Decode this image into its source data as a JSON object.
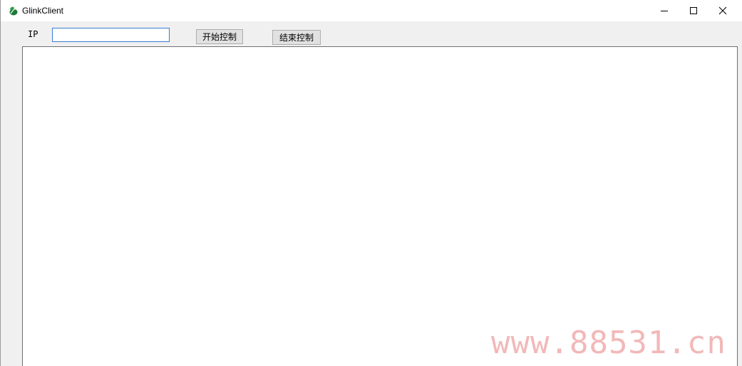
{
  "window": {
    "title": "GlinkClient",
    "icon": "leaf-app-icon",
    "controls": {
      "minimize": "minimize-icon",
      "maximize": "maximize-icon",
      "close": "close-icon"
    }
  },
  "toolbar": {
    "ip_label": "IP",
    "ip_value": "",
    "start_label": "开始控制",
    "stop_label": "结束控制"
  },
  "watermark": {
    "text": "www.88531.cn"
  },
  "colors": {
    "accent": "#3a7bd5",
    "window_bg": "#f0f0f0",
    "watermark": "#f2b8b8",
    "app_icon": "#1f7a3a"
  }
}
